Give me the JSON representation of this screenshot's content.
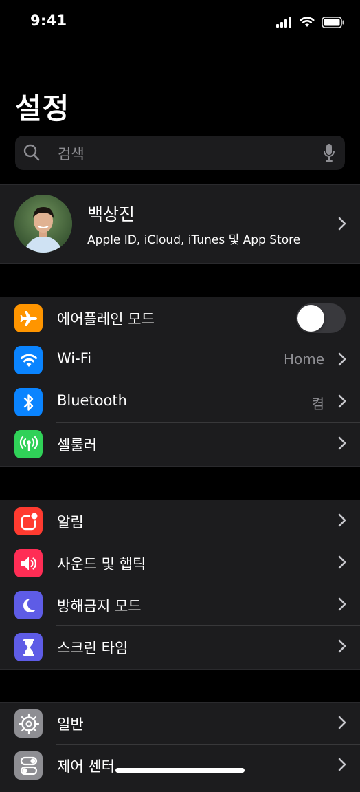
{
  "status_bar": {
    "time": "9:41"
  },
  "header": {
    "title": "설정"
  },
  "search": {
    "placeholder": "검색"
  },
  "profile": {
    "name": "백상진",
    "subtitle": "Apple ID, iCloud, iTunes 및 App Store"
  },
  "connectivity": [
    {
      "label": "에어플레인 모드",
      "icon": "airplane-icon",
      "color": "#ff9500",
      "toggle": false
    },
    {
      "label": "Wi-Fi",
      "icon": "wifi-icon",
      "color": "#0a84ff",
      "value": "Home"
    },
    {
      "label": "Bluetooth",
      "icon": "bluetooth-icon",
      "color": "#0a84ff",
      "value": "켬"
    },
    {
      "label": "셀룰러",
      "icon": "antenna-icon",
      "color": "#30d158"
    }
  ],
  "notifications": [
    {
      "label": "알림",
      "icon": "notifications-icon",
      "color": "#ff3b30"
    },
    {
      "label": "사운드 및 햅틱",
      "icon": "speaker-icon",
      "color": "#ff2d55"
    },
    {
      "label": "방해금지 모드",
      "icon": "moon-icon",
      "color": "#5e5ce6"
    },
    {
      "label": "스크린 타임",
      "icon": "hourglass-icon",
      "color": "#5e5ce6"
    }
  ],
  "general": [
    {
      "label": "일반",
      "icon": "gear-icon",
      "color": "#8e8e93"
    },
    {
      "label": "제어 센터",
      "icon": "switches-icon",
      "color": "#8e8e93"
    }
  ]
}
